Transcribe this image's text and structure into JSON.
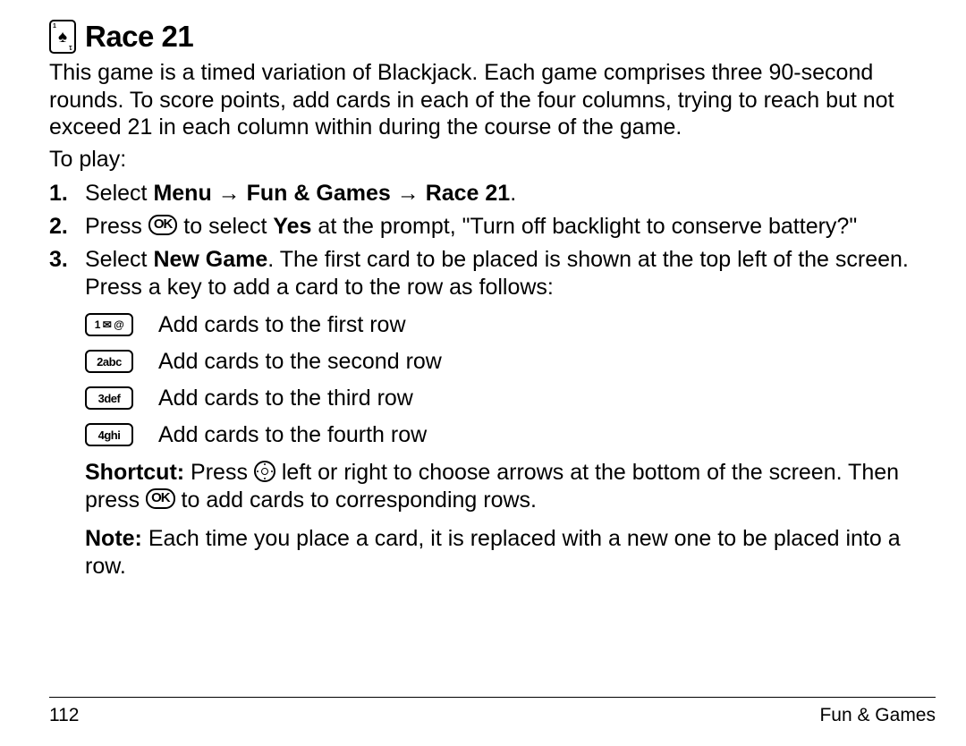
{
  "heading": {
    "title": "Race 21"
  },
  "intro": "This game is a timed variation of Blackjack. Each game comprises three 90-second rounds. To score points, add cards in each of the four columns, trying to reach but not exceed 21 in each column within during the course of the game.",
  "toplay": "To play:",
  "steps": {
    "s1": {
      "num": "1.",
      "pre": "Select ",
      "menu": "Menu",
      "arrow1": " → ",
      "fun": "Fun & Games",
      "arrow2": " → ",
      "race": "Race 21",
      "post": "."
    },
    "s2": {
      "num": "2.",
      "pre": "Press ",
      "ok": "OK",
      "mid": " to select ",
      "yes": "Yes",
      "post": " at the prompt, \"Turn off backlight to conserve battery?\""
    },
    "s3": {
      "num": "3.",
      "pre": "Select ",
      "ng": "New Game",
      "post": ". The first card to be placed is shown at the top left of the screen. Press a key to add a card to the row as follows:"
    }
  },
  "keys": {
    "k1": {
      "label": "1 ✉ @",
      "desc": "Add cards to the first row"
    },
    "k2": {
      "label": "2abc",
      "desc": "Add cards to the second row"
    },
    "k3": {
      "label": "3def",
      "desc": "Add cards to the third row"
    },
    "k4": {
      "label": "4ghi",
      "desc": "Add cards to the fourth row"
    }
  },
  "shortcut": {
    "label": "Shortcut: ",
    "pre": "Press ",
    "mid": " left or right to choose arrows at the bottom of the screen. Then press ",
    "ok": "OK",
    "post": " to add cards to corresponding rows."
  },
  "note": {
    "label": "Note: ",
    "text": "Each time you place a card, it is replaced with a new one to be placed into a row."
  },
  "footer": {
    "page": "112",
    "section": "Fun & Games"
  }
}
